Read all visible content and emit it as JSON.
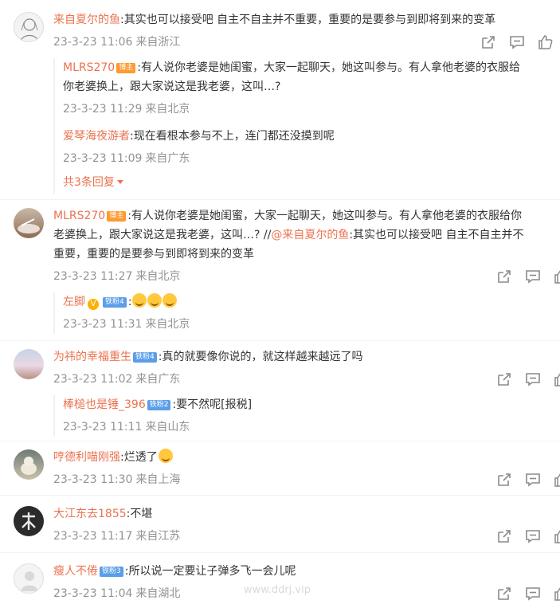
{
  "comments": [
    {
      "user": "来自夏尔的鱼",
      "text": ":其实也可以接受吧 自主不自主并不重要，重要的是要参与到即将到来的变革",
      "time": "23-3-23 11:06",
      "location": "来自浙江",
      "replies": [
        {
          "user": "MLRS270",
          "badge": "博主",
          "text_line1": ":有人说你老婆是她闺蜜，大家一起聊天，她这叫参与。有人拿他老婆的衣服给",
          "text_line2": "你老婆换上，跟大家说这是我老婆，这叫…?",
          "time": "23-3-23 11:29",
          "location": "来自北京"
        },
        {
          "user": "爱琴海夜游者",
          "text": ":现在看根本参与不上，连门都还没摸到呢",
          "time": "23-3-23 11:09",
          "location": "来自广东"
        }
      ],
      "more_replies": "共3条回复"
    },
    {
      "user": "MLRS270",
      "badge": "博主",
      "line1": ":有人说你老婆是她闺蜜，大家一起聊天，她这叫参与。有人拿他老婆的衣服给你",
      "line2a": "老婆换上，跟大家说这是我老婆，这叫…? //",
      "at_user": "@来自夏尔的鱼",
      "line2b": ":其实也可以接受吧 自主不自主并不",
      "line3": "重要，重要的是要参与到即将到来的变革",
      "time": "23-3-23 11:27",
      "location": "来自北京",
      "reply": {
        "user": "左脚",
        "fan_badge": "铁粉4",
        "time": "23-3-23 11:31",
        "location": "来自北京"
      }
    },
    {
      "user": "为祎的幸福重生",
      "fan_badge": "铁粉4",
      "text": ":真的就要像你说的，就这样越来越远了吗",
      "time": "23-3-23 11:02",
      "location": "来自广东",
      "reply": {
        "user": "棒槌也是锤_396",
        "fan_badge": "铁粉2",
        "text": ":要不然呢[报税]",
        "time": "23-3-23 11:11",
        "location": "来自山东"
      }
    },
    {
      "user": "哼德利喵刚强",
      "text": ":烂透了",
      "time": "23-3-23 11:30",
      "location": "来自上海"
    },
    {
      "user": "大江东去1855",
      "text": ":不堪",
      "time": "23-3-23 11:17",
      "location": "来自江苏"
    },
    {
      "user": "瘦人不倦",
      "fan_badge": "铁粉3",
      "text": ":所以说一定要让子弹多飞一会儿呢",
      "time": "23-3-23 11:04",
      "location": "来自湖北"
    }
  ],
  "watermark": "www.ddrj.vip",
  "icons": {
    "share": "share-icon",
    "comment": "comment-icon",
    "like": "like-icon"
  },
  "colors": {
    "name": "#eb7350",
    "meta": "#939393",
    "boz_badge": "#ff9a2e",
    "fan_badge": "#5b9ee8"
  }
}
